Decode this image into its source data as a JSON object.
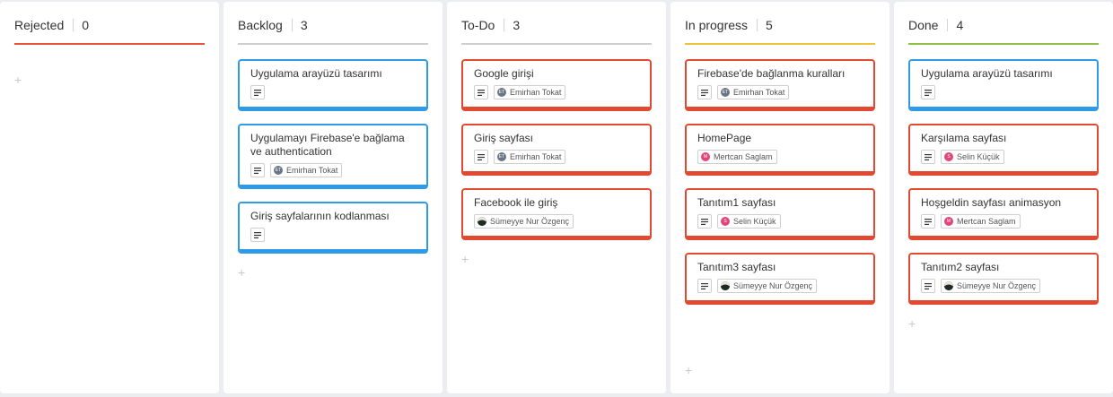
{
  "colors": {
    "rejected": "#e8553c",
    "backlog": "#cfcfcf",
    "todo": "#cfcfcf",
    "in_progress": "#f0c238",
    "done": "#8cc04a",
    "card_blue": "#2f9be6",
    "card_red": "#e14a31"
  },
  "columns": [
    {
      "title": "Rejected",
      "count": "0",
      "line_color": "#e8553c",
      "cards": [],
      "add_icon": "+"
    },
    {
      "title": "Backlog",
      "count": "3",
      "line_color": "#cfcfcf",
      "cards": [
        {
          "title": "Uygulama arayüzü tasarımı",
          "color": "blue",
          "icon": "description-icon",
          "assignee": null
        },
        {
          "title": "Uygulamayı Firebase'e bağlama ve authentication",
          "color": "blue",
          "icon": "description-icon",
          "assignee": {
            "name": "Emirhan Tokat",
            "initials": "ET",
            "avatar_color": "#6a7685"
          }
        },
        {
          "title": "Giriş sayfalarının kodlanması",
          "color": "blue",
          "icon": "description-icon",
          "assignee": null
        }
      ],
      "add_icon": "+"
    },
    {
      "title": "To-Do",
      "count": "3",
      "line_color": "#cfcfcf",
      "cards": [
        {
          "title": "Google girişi",
          "color": "red",
          "icon": "description-icon",
          "assignee": {
            "name": "Emirhan Tokat",
            "initials": "ET",
            "avatar_color": "#6a7685"
          }
        },
        {
          "title": "Giriş sayfası",
          "color": "red",
          "icon": "description-icon",
          "assignee": {
            "name": "Emirhan Tokat",
            "initials": "ET",
            "avatar_color": "#6a7685"
          }
        },
        {
          "title": "Facebook ile giriş",
          "color": "red",
          "icon": null,
          "assignee": {
            "name": "Sümeyye Nur Özgenç",
            "initials": "",
            "avatar_color": "#1e2b22"
          }
        }
      ],
      "add_icon": "+"
    },
    {
      "title": "In progress",
      "count": "5",
      "line_color": "#f0c238",
      "cards": [
        {
          "title": "Firebase'de bağlanma kuralları",
          "color": "red",
          "icon": "description-icon",
          "assignee": {
            "name": "Emirhan Tokat",
            "initials": "ET",
            "avatar_color": "#6a7685"
          }
        },
        {
          "title": "HomePage",
          "color": "red",
          "icon": null,
          "assignee": {
            "name": "Mertcan Saglam",
            "initials": "M",
            "avatar_color": "#e0457b"
          }
        },
        {
          "title": "Tanıtım1 sayfası",
          "color": "red",
          "icon": "description-icon",
          "assignee": {
            "name": "Selin Küçük",
            "initials": "S",
            "avatar_color": "#e0457b"
          }
        },
        {
          "title": "Tanıtım3 sayfası",
          "color": "red",
          "icon": "description-icon",
          "assignee": {
            "name": "Sümeyye Nur Özgenç",
            "initials": "",
            "avatar_color": "#1e2b22"
          }
        }
      ],
      "add_icon": "+"
    },
    {
      "title": "Done",
      "count": "4",
      "line_color": "#8cc04a",
      "cards": [
        {
          "title": "Uygulama arayüzü tasarımı",
          "color": "blue",
          "icon": "description-icon",
          "assignee": null
        },
        {
          "title": "Karşılama sayfası",
          "color": "red",
          "icon": "description-icon",
          "assignee": {
            "name": "Selin Küçük",
            "initials": "S",
            "avatar_color": "#e0457b"
          }
        },
        {
          "title": "Hoşgeldin sayfası animasyon",
          "color": "red",
          "icon": "description-icon",
          "assignee": {
            "name": "Mertcan Saglam",
            "initials": "M",
            "avatar_color": "#e0457b"
          }
        },
        {
          "title": "Tanıtım2 sayfası",
          "color": "red",
          "icon": "description-icon",
          "assignee": {
            "name": "Sümeyye Nur Özgenç",
            "initials": "",
            "avatar_color": "#1e2b22"
          }
        }
      ],
      "add_icon": "+"
    }
  ]
}
